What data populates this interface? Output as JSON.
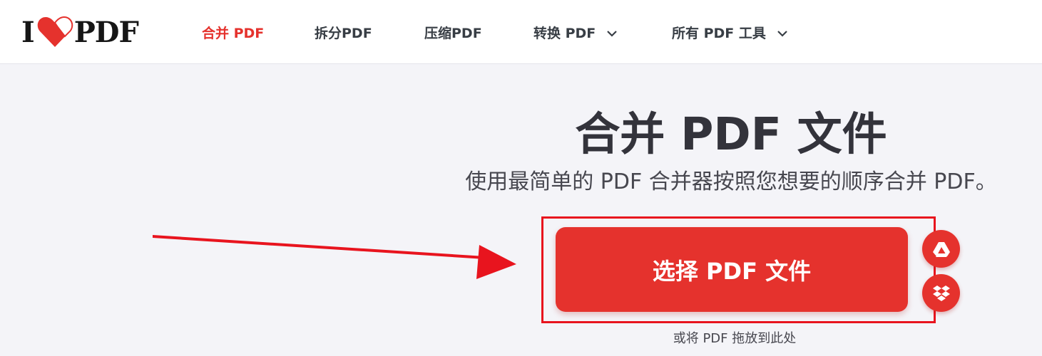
{
  "header": {
    "logo": {
      "left": "I",
      "right": "PDF"
    },
    "nav": [
      {
        "label": "合并 PDF",
        "active": true,
        "dropdown": false
      },
      {
        "label": "拆分PDF",
        "active": false,
        "dropdown": false
      },
      {
        "label": "压缩PDF",
        "active": false,
        "dropdown": false
      },
      {
        "label": "转换 PDF",
        "active": false,
        "dropdown": true
      },
      {
        "label": "所有 PDF 工具",
        "active": false,
        "dropdown": true
      }
    ]
  },
  "hero": {
    "title": "合并 PDF 文件",
    "subtitle": "使用最简单的 PDF 合并器按照您想要的顺序合并 PDF。",
    "select_button": "选择 PDF 文件",
    "drop_hint": "或将 PDF 拖放到此处",
    "cloud_buttons": [
      "google-drive-icon",
      "dropbox-icon"
    ]
  },
  "colors": {
    "brand": "#e5322d",
    "annotation": "#e8141e",
    "text": "#33333b",
    "background": "#f4f4f8"
  }
}
